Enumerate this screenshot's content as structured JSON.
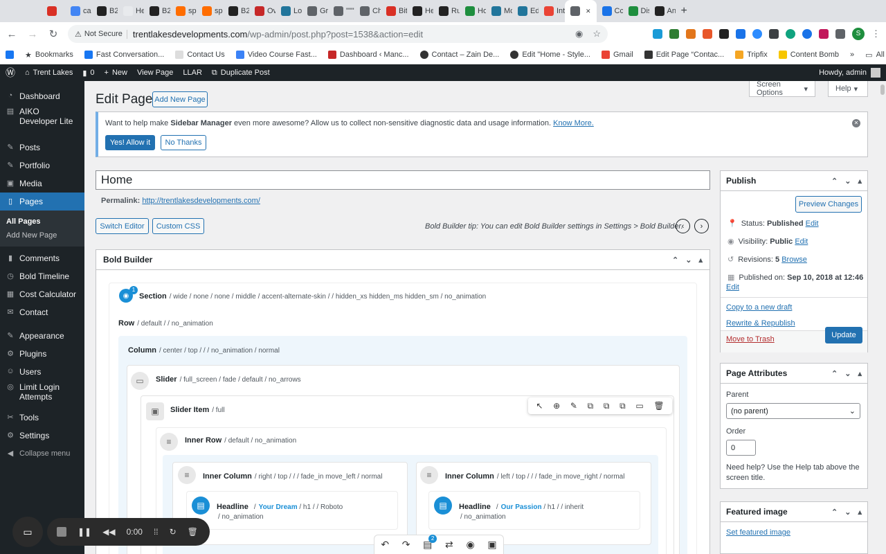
{
  "browser": {
    "tabs": [
      {
        "label": "",
        "icon": "record-icon"
      },
      {
        "label": "ca",
        "icon": "google-icon"
      },
      {
        "label": "B2",
        "icon": "b-icon"
      },
      {
        "label": "He",
        "icon": "page-icon"
      },
      {
        "label": "B2",
        "icon": "b-icon"
      },
      {
        "label": "sp",
        "icon": "sp-icon"
      },
      {
        "label": "sp",
        "icon": "sp-icon"
      },
      {
        "label": "B2",
        "icon": "b-icon"
      },
      {
        "label": "Ov",
        "icon": "ov-icon"
      },
      {
        "label": "Lo",
        "icon": "wp-icon"
      },
      {
        "label": "Gr",
        "icon": "gr-icon"
      },
      {
        "label": "\"\"\"",
        "icon": "globe-icon"
      },
      {
        "label": "Ch",
        "icon": "ch-icon"
      },
      {
        "label": "Bit",
        "icon": "bit-icon"
      },
      {
        "label": "He",
        "icon": "he-icon"
      },
      {
        "label": "Ru",
        "icon": "r-icon"
      },
      {
        "label": "Ho",
        "icon": "drive-icon"
      },
      {
        "label": "Mc",
        "icon": "wp-icon"
      },
      {
        "label": "Ed",
        "icon": "wp-icon"
      },
      {
        "label": "Int",
        "icon": "gmail-icon"
      },
      {
        "label": "",
        "icon": "audio-icon",
        "active": true
      },
      {
        "label": "Cc",
        "icon": "cc-icon"
      },
      {
        "label": "Dis",
        "icon": "dis-icon"
      },
      {
        "label": "An",
        "icon": "amazon-icon"
      }
    ],
    "not_secure": "Not Secure",
    "url_host": "trentlakesdevelopments.com",
    "url_path": "/wp-admin/post.php?post=1538&action=edit",
    "profile_initial": "S",
    "bookmarks": [
      "Bookmarks",
      "Fast Conversation...",
      "Contact Us",
      "Video Course Fast...",
      "Dashboard ‹ Manc...",
      "Contact – Zain De...",
      "Edit \"Home - Style...",
      "Gmail",
      "Edit Page “Contac...",
      "Tripfix",
      "Content Bomb"
    ],
    "all_bookmarks": "All Bookmarks"
  },
  "adminbar": {
    "site": "Trent Lakes",
    "comments": "0",
    "new": "New",
    "view_page": "View Page",
    "llar": "LLAR",
    "duplicate": "Duplicate Post",
    "howdy": "Howdy, admin"
  },
  "sidebar": {
    "items": [
      {
        "label": "Dashboard",
        "icon": "dashboard-icon"
      },
      {
        "label": "AIKO Developer Lite",
        "icon": "aiko-icon"
      },
      {
        "label": "Posts",
        "icon": "pin-icon"
      },
      {
        "label": "Portfolio",
        "icon": "portfolio-icon"
      },
      {
        "label": "Media",
        "icon": "media-icon"
      },
      {
        "label": "Pages",
        "icon": "pages-icon"
      },
      {
        "label": "Comments",
        "icon": "comments-icon"
      },
      {
        "label": "Bold Timeline",
        "icon": "timeline-icon"
      },
      {
        "label": "Cost Calculator",
        "icon": "calculator-icon"
      },
      {
        "label": "Contact",
        "icon": "mail-icon"
      },
      {
        "label": "Appearance",
        "icon": "appearance-icon"
      },
      {
        "label": "Plugins",
        "icon": "plugins-icon"
      },
      {
        "label": "Users",
        "icon": "users-icon"
      },
      {
        "label": "Limit Login Attempts",
        "icon": "limit-icon"
      },
      {
        "label": "Tools",
        "icon": "tools-icon"
      },
      {
        "label": "Settings",
        "icon": "settings-icon"
      }
    ],
    "submenu": [
      "All Pages",
      "Add New Page"
    ],
    "collapse": "Collapse menu"
  },
  "page": {
    "screen_options": "Screen Options",
    "help": "Help",
    "title": "Edit Page",
    "add_new": "Add New Page",
    "notice_pre": "Want to help make ",
    "notice_bold": "Sidebar Manager",
    "notice_post": " even more awesome? Allow us to collect non-sensitive diagnostic data and usage information. ",
    "notice_link": "Know More.",
    "allow": "Yes! Allow it",
    "no_thanks": "No Thanks",
    "post_title": "Home",
    "permalink_label": "Permalink:",
    "permalink_url": "http://trentlakesdevelopments.com/",
    "switch_editor": "Switch Editor",
    "custom_css": "Custom CSS",
    "tip": "Bold Builder tip: You can edit Bold Builder settings in Settings > Bold Builder."
  },
  "builder": {
    "heading": "Bold Builder",
    "section_label": "Section",
    "section_badge": "1",
    "section_attrs": "/  wide  /  none  /  none  /  middle  /  accent-alternate-skin  /    /  hidden_xs hidden_ms hidden_sm  /  no_animation",
    "row_label": "Row",
    "row_attrs": "/  default  /    /  no_animation",
    "column_label": "Column",
    "column_attrs": "/  center  /  top  /    /    /  no_animation  /  normal",
    "slider_label": "Slider",
    "slider_attrs": "/  full_screen  /  fade  /  default  /  no_arrows",
    "slider_item_label": "Slider Item",
    "slider_item_attrs": "/  full",
    "inner_row_label": "Inner Row",
    "inner_row_attrs": "/  default  /  no_animation",
    "inner_col1_label": "Inner Column",
    "inner_col1_attrs": "/  right  /  top  /    /    /  fade_in move_left  /  normal",
    "inner_col2_label": "Inner Column",
    "inner_col2_attrs": "/  left  /  top  /    /    /  fade_in move_right  /  normal",
    "headline1_label": "Headline",
    "headline1_text": "Your Dream",
    "headline1_attrs": "/  h1  /    /  Roboto",
    "headline1_anim": "/  no_animation",
    "headline2_label": "Headline",
    "headline2_text": "Our Passion",
    "headline2_attrs": "/  h1  /    /  inherit",
    "headline2_anim": "/  no_animation",
    "toolbar_badge": "2"
  },
  "publish": {
    "heading": "Publish",
    "preview": "Preview Changes",
    "status_label": "Status: ",
    "status_value": "Published",
    "visibility_label": "Visibility: ",
    "visibility_value": "Public",
    "revisions_label": "Revisions: ",
    "revisions_value": "5",
    "browse": "Browse",
    "published_label": "Published on: ",
    "published_value": "Sep 10, 2018 at 12:46",
    "edit": "Edit",
    "copy_draft": "Copy to a new draft",
    "rewrite": "Rewrite & Republish",
    "trash": "Move to Trash",
    "update": "Update"
  },
  "attributes": {
    "heading": "Page Attributes",
    "parent_label": "Parent",
    "parent_value": "(no parent)",
    "order_label": "Order",
    "order_value": "0",
    "help_text_1": "Need help? Use the Help tab above the",
    "help_text_2": "screen title."
  },
  "featured": {
    "heading": "Featured image",
    "link": "Set featured image"
  },
  "recorder": {
    "time": "0:00"
  },
  "colors": {
    "wp_blue": "#2271b1",
    "admin_dark": "#1d2327",
    "builder_blue": "#1a8fd6",
    "trash_red": "#b32d2e"
  }
}
